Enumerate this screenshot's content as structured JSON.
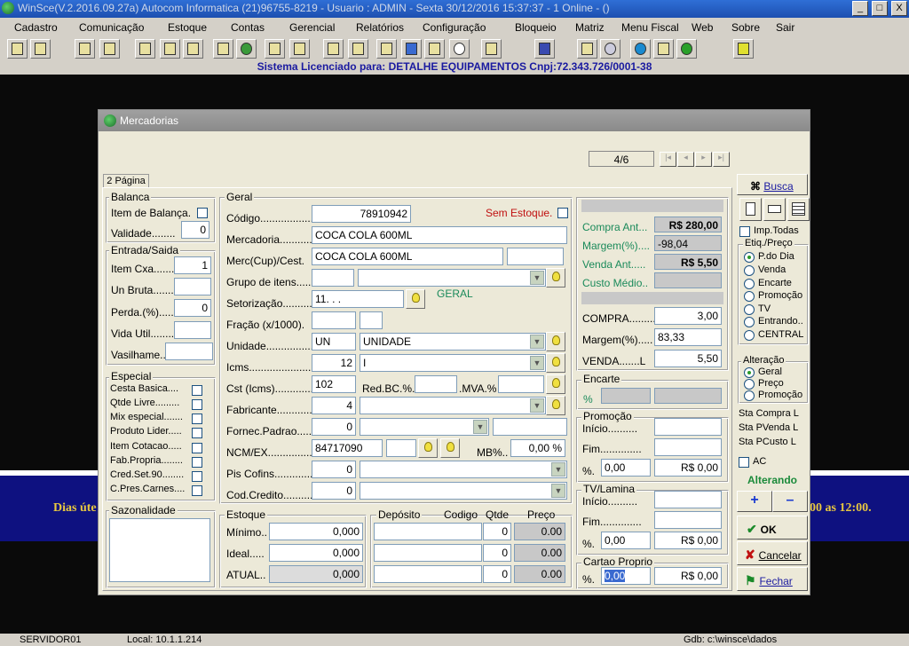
{
  "window": {
    "title": "WinSce(V.2.2016.09.27a) Autocom Informatica (21)96755-8219 -  Usuario : ADMIN - Sexta 30/12/2016 15:37:37 - 1 Online - ()",
    "min": "_",
    "max": "□",
    "close": "X"
  },
  "menu": [
    "Cadastro",
    "Comunicação",
    "Estoque",
    "Contas",
    "Gerencial",
    "Relatórios",
    "Configuração",
    "Bloqueio",
    "Matriz",
    "Menu Fiscal",
    "Web",
    "Sobre",
    "Sair"
  ],
  "license": "Sistema Licenciado para: DETALHE EQUIPAMENTOS Cnpj:72.343.726/0001-38",
  "background": {
    "left_text": "Dias úte",
    "right_text": "00 as 12:00."
  },
  "statusbar": {
    "server": "SERVIDOR01",
    "local": "Local: 10.1.1.214",
    "gdb": "Gdb: c:\\winsce\\dados"
  },
  "dialog": {
    "title": "Mercadorias",
    "nav_counter": "4/6",
    "tab": "2 Página",
    "balanca": {
      "title": "Balanca",
      "item_label": "Item de Balança.",
      "validade_label": "Validade........",
      "validade": "0"
    },
    "entrada": {
      "title": "Entrada/Saida",
      "item_cxa_label": "Item Cxa..........",
      "item_cxa": "1",
      "un_bruta_label": "Un Bruta.........",
      "perda_label": "Perda.(%).......",
      "perda": "0",
      "vida_util_label": "Vida Util.........",
      "vasilhame_label": "Vasilhame......"
    },
    "especial": {
      "title": "Especial",
      "items": [
        "Cesta Basica....",
        "Qtde Livre.........",
        "Mix especial.......",
        "Produto Lider.....",
        "Item Cotacao.....",
        "Fab.Propria........",
        "Cred.Set.90........",
        "C.Pres.Carnes...."
      ]
    },
    "sazonalidade": {
      "title": "Sazonalidade"
    },
    "geral": {
      "title": "Geral",
      "codigo_label": "Código...................",
      "codigo": "78910942",
      "sem_estoque": "Sem Estoque.",
      "mercadoria_label": "Mercadoria............",
      "mercadoria": "COCA COLA 600ML",
      "merc_cup_label": "Merc(Cup)/Cest.",
      "merc_cup": "COCA COLA 600ML",
      "grupo_label": "Grupo de itens.....",
      "setorizacao_label": "Setorização...........",
      "setorizacao": "11.  .  .",
      "setorizacao_desc": "GERAL",
      "fracao_label": "Fração (x/1000).",
      "unidade_label": "Unidade..................",
      "unidade": "UN",
      "unidade_desc": "UNIDADE",
      "icms_label": "Icms.........................",
      "icms": "12",
      "icms_desc": "I",
      "cst_label": "Cst (Icms)..............",
      "cst": "102",
      "redbc_label": "Red.BC.%.",
      "mva_label": ".MVA.%",
      "fabricante_label": "Fabricante..............",
      "fabricante": "4",
      "fornec_label": "Fornec.Padrao.....",
      "fornec": "0",
      "ncm_label": "NCM/EX.................",
      "ncm": "84717090",
      "mb_label": "MB%..",
      "mb": "0,00 %",
      "pis_label": "Pis Cofins..............",
      "pis": "0",
      "cod_credito_label": "Cod.Credito...........",
      "cod_credito": "0"
    },
    "estoque": {
      "title": "Estoque",
      "minimo_label": "Mínimo..",
      "minimo": "0,000",
      "ideal_label": "Ideal.....",
      "ideal": "0,000",
      "atual_label": "ATUAL..",
      "atual": "0,000"
    },
    "deposito": {
      "headers": [
        "Depósito",
        "Codigo",
        "Qtde",
        "Preço"
      ],
      "rows": [
        {
          "qtde": "0",
          "preco": "0.00"
        },
        {
          "qtde": "0",
          "preco": "0.00"
        },
        {
          "qtde": "0",
          "preco": "0.00"
        }
      ]
    },
    "precos": {
      "compra_ant_label": "Compra Ant...",
      "compra_ant": "R$ 280,00",
      "margem_ant_label": "Margem(%)....",
      "margem_ant": "-98,04",
      "venda_ant_label": "Venda Ant.....",
      "venda_ant": "R$ 5,50",
      "custo_medio_label": "Custo Médio..",
      "compra_label": "COMPRA.........",
      "compra": "3,00",
      "margem_label": "Margem(%).....",
      "margem": "83,33",
      "venda_label": "VENDA.......L",
      "venda": "5,50"
    },
    "encarte": {
      "title": "Encarte",
      "pct": "%"
    },
    "promocao": {
      "title": "Promoção",
      "inicio": "Início..........",
      "fim": "Fim..............",
      "pct": "%.",
      "valor": "0,00",
      "rs": "R$ 0,00"
    },
    "tvlamina": {
      "title": "TV/Lamina",
      "inicio": "Início..........",
      "fim": "Fim..............",
      "pct": "%.",
      "valor": "0,00",
      "rs": "R$ 0,00"
    },
    "cartao": {
      "title": "Cartao Proprio",
      "pct": "%.",
      "valor": "0,00",
      "rs": "R$ 0,00"
    },
    "sidebar": {
      "busca": "Busca",
      "imp_todas": "Imp.Todas",
      "etiq_title": "Etiq./Preço",
      "etiq_options": [
        "P.do Dia",
        "Venda",
        "Encarte",
        "Promoção",
        "TV",
        "Entrando..",
        "CENTRAL"
      ],
      "alteracao_title": "Alteração",
      "alteracao_options": [
        "Geral",
        "Preço",
        "Promoção"
      ],
      "sta_compra": "Sta Compra  L",
      "sta_pvenda": "Sta PVenda  L",
      "sta_pcusto": "Sta PCusto   L",
      "ac": "AC",
      "status": "Alterando",
      "plus": "+",
      "minus": "–",
      "ok": "OK",
      "cancelar": "Cancelar",
      "fechar": "Fechar"
    }
  }
}
